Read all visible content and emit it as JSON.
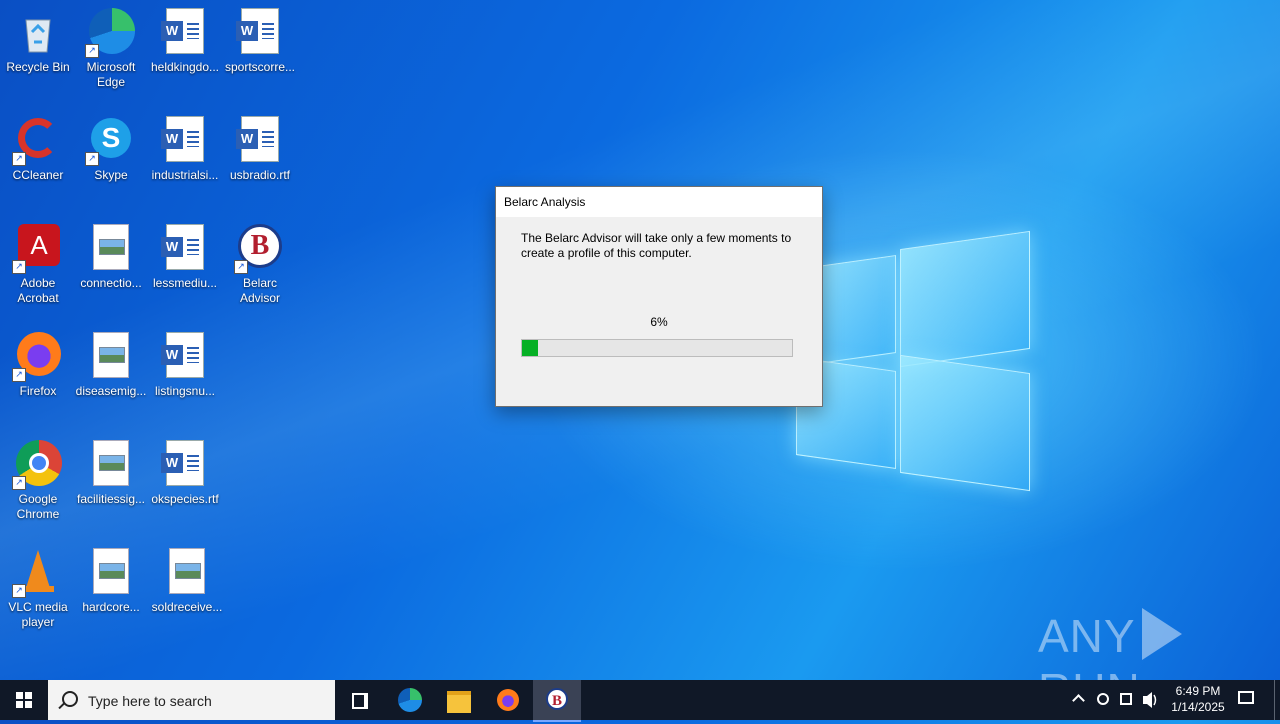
{
  "desktop": {
    "icons": [
      {
        "label": "Recycle Bin"
      },
      {
        "label": "Microsoft Edge"
      },
      {
        "label": "heldkingdo..."
      },
      {
        "label": "sportscorre..."
      },
      {
        "label": "CCleaner"
      },
      {
        "label": "Skype"
      },
      {
        "label": "industrialsi..."
      },
      {
        "label": "usbradio.rtf"
      },
      {
        "label": "Adobe Acrobat"
      },
      {
        "label": "connectio..."
      },
      {
        "label": "lessmediu..."
      },
      {
        "label": "Belarc Advisor"
      },
      {
        "label": "Firefox"
      },
      {
        "label": "diseasemig..."
      },
      {
        "label": "listingsnu..."
      },
      {
        "label": "Google Chrome"
      },
      {
        "label": "facilitiessig..."
      },
      {
        "label": "okspecies.rtf"
      },
      {
        "label": "VLC media player"
      },
      {
        "label": "hardcore..."
      },
      {
        "label": "soldreceive..."
      }
    ]
  },
  "dialog": {
    "title": "Belarc Analysis",
    "message": "The Belarc Advisor will take only a few moments to create a profile of this computer.",
    "percent_label": "6%",
    "progress_fraction": 0.06,
    "progress_color": "#06b025"
  },
  "watermark": {
    "text_left": "ANY",
    "text_right": "RUN"
  },
  "taskbar": {
    "search_placeholder": "Type here to search",
    "pinned": [
      "task-view-icon",
      "edge-icon",
      "file-explorer-icon",
      "firefox-icon",
      "belarc-icon"
    ],
    "clock_time": "6:49 PM",
    "clock_date": "1/14/2025"
  }
}
